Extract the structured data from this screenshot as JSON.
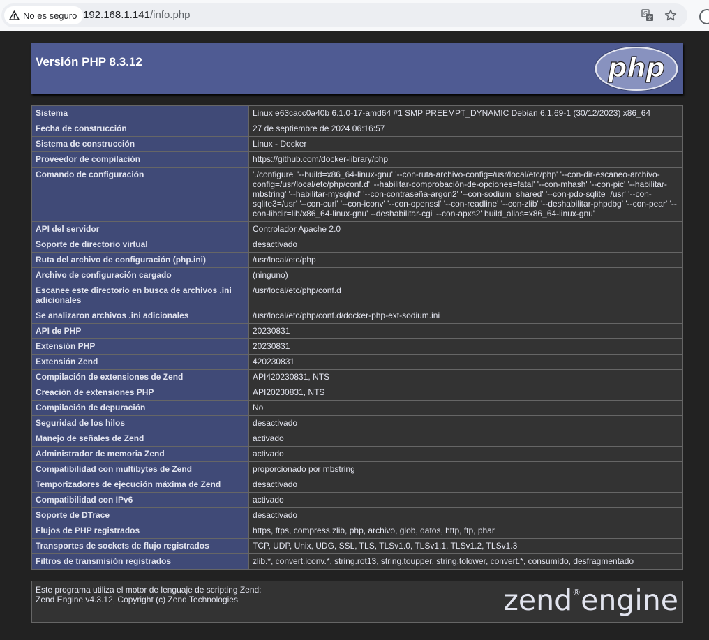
{
  "browser": {
    "security_label": "No es seguro",
    "url_host": "192.168.1.141",
    "url_path": "/info.php"
  },
  "header": {
    "title": "Versión PHP 8.3.12",
    "logo_text": "php"
  },
  "rows": [
    {
      "label": "Sistema",
      "value": "Linux e63cacc0a40b 6.1.0-17-amd64 #1 SMP PREEMPT_DYNAMIC Debian 6.1.69-1 (30/12/2023) x86_64"
    },
    {
      "label": "Fecha de construcción",
      "value": "27 de septiembre de 2024 06:16:57"
    },
    {
      "label": "Sistema de construcción",
      "value": "Linux - Docker"
    },
    {
      "label": "Proveedor de compilación",
      "value": "https://github.com/docker-library/php"
    },
    {
      "label": "Comando de configuración",
      "value": "'./configure' '--build=x86_64-linux-gnu' '--con-ruta-archivo-config=/usr/local/etc/php' '--con-dir-escaneo-archivo-config=/usr/local/etc/php/conf.d' '--habilitar-comprobación-de-opciones=fatal' '--con-mhash' '--con-pic' '--habilitar-mbstring' '--habilitar-mysqlnd' '--con-contraseña-argon2' '--con-sodium=shared' '--con-pdo-sqlite=/usr' '--con-sqlite3=/usr' '--con-curl' '--con-iconv' '--con-openssl' '--con-readline' '--con-zlib' '--deshabilitar-phpdbg' '--con-pear' '--con-libdir=lib/x86_64-linux-gnu' --deshabilitar-cgi' --con-apxs2' build_alias=x86_64-linux-gnu'"
    },
    {
      "label": "API del servidor",
      "value": "Controlador Apache 2.0"
    },
    {
      "label": "Soporte de directorio virtual",
      "value": "desactivado"
    },
    {
      "label": "Ruta del archivo de configuración (php.ini)",
      "value": "/usr/local/etc/php"
    },
    {
      "label": "Archivo de configuración cargado",
      "value": "(ninguno)"
    },
    {
      "label": "Escanee este directorio en busca de archivos .ini adicionales",
      "value": "/usr/local/etc/php/conf.d"
    },
    {
      "label": "Se analizaron archivos .ini adicionales",
      "value": "/usr/local/etc/php/conf.d/docker-php-ext-sodium.ini"
    },
    {
      "label": "API de PHP",
      "value": "20230831"
    },
    {
      "label": "Extensión PHP",
      "value": "20230831"
    },
    {
      "label": "Extensión Zend",
      "value": "420230831"
    },
    {
      "label": "Compilación de extensiones de Zend",
      "value": "API420230831, NTS"
    },
    {
      "label": "Creación de extensiones PHP",
      "value": "API20230831, NTS"
    },
    {
      "label": "Compilación de depuración",
      "value": "No"
    },
    {
      "label": "Seguridad de los hilos",
      "value": "desactivado"
    },
    {
      "label": "Manejo de señales de Zend",
      "value": "activado"
    },
    {
      "label": "Administrador de memoria Zend",
      "value": "activado"
    },
    {
      "label": "Compatibilidad con multibytes de Zend",
      "value": "proporcionado por mbstring"
    },
    {
      "label": "Temporizadores de ejecución máxima de Zend",
      "value": "desactivado"
    },
    {
      "label": "Compatibilidad con IPv6",
      "value": "activado"
    },
    {
      "label": "Soporte de DTrace",
      "value": "desactivado"
    },
    {
      "label": "Flujos de PHP registrados",
      "value": "https, ftps, compress.zlib, php, archivo, glob, datos, http, ftp, phar"
    },
    {
      "label": "Transportes de sockets de flujo registrados",
      "value": "TCP, UDP, Unix, UDG, SSL, TLS, TLSv1.0, TLSv1.1, TLSv1.2, TLSv1.3"
    },
    {
      "label": "Filtros de transmisión registrados",
      "value": "zlib.*, convert.iconv.*, string.rot13, string.toupper, string.tolower, convert.*, consumido, desfragmentado"
    }
  ],
  "zend": {
    "line1": "Este programa utiliza el motor de lenguaje de scripting Zend:",
    "line2": "Zend Engine v4.3.12, Copyright (c) Zend Technologies",
    "logo_left": "zend",
    "logo_right": "engine"
  },
  "colors": {
    "header_bg": "#4F5B93",
    "label_bg": "#404A77",
    "value_bg": "#333333",
    "page_bg": "#222222"
  }
}
